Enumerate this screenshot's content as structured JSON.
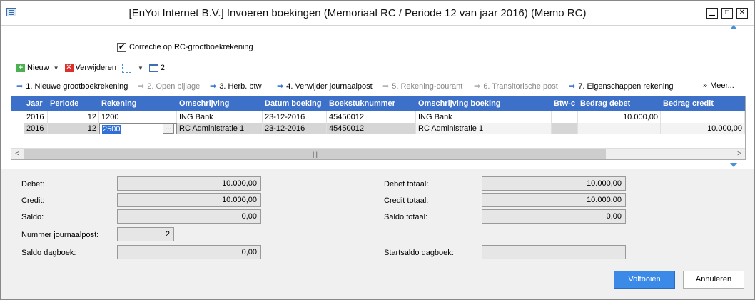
{
  "window": {
    "title": "[EnYoi Internet B.V.]  Invoeren boekingen (Memoriaal RC / Periode 12 van jaar 2016) (Memo RC)",
    "min_glyph": "▁",
    "max_glyph": "□",
    "close_glyph": "✕"
  },
  "checkbox": {
    "label": "Correctie op RC-grootboekrekening",
    "checked": true
  },
  "toolbar": {
    "new_label": "Nieuw",
    "delete_label": "Verwijderen",
    "calendar_count": "2"
  },
  "steps": [
    {
      "label": "1. Nieuwe grootboekrekening",
      "enabled": true
    },
    {
      "label": "2. Open bijlage",
      "enabled": false
    },
    {
      "label": "3. Herb. btw",
      "enabled": true
    },
    {
      "label": "4. Verwijder journaalpost",
      "enabled": true
    },
    {
      "label": "5. Rekening-courant",
      "enabled": false
    },
    {
      "label": "6. Transitorische post",
      "enabled": false
    },
    {
      "label": "7. Eigenschappen rekening",
      "enabled": true
    },
    {
      "label": "Meer...",
      "enabled": true
    }
  ],
  "grid": {
    "columns": [
      "Jaar",
      "Periode",
      "Rekening",
      "Omschrijving",
      "Datum boeking",
      "Boekstuknummer",
      "Omschrijving boeking",
      "Btw-c",
      "Bedrag debet",
      "Bedrag credit"
    ],
    "rows": [
      {
        "jaar": "2016",
        "periode": "12",
        "rekening": "1200",
        "omschrijving": "ING Bank",
        "datum": "23-12-2016",
        "boekstuk": "45450012",
        "omschrijving_boeking": "ING Bank",
        "btw": "",
        "debet": "10.000,00",
        "credit": ""
      },
      {
        "jaar": "2016",
        "periode": "12",
        "rekening": "2500",
        "omschrijving": "RC Administratie 1",
        "datum": "23-12-2016",
        "boekstuk": "45450012",
        "omschrijving_boeking": "RC Administratie 1",
        "btw": "",
        "debet": "",
        "credit": "10.000,00"
      }
    ],
    "scroll_thumb_glyph": "|||"
  },
  "summary": {
    "debet_label": "Debet:",
    "debet_value": "10.000,00",
    "credit_label": "Credit:",
    "credit_value": "10.000,00",
    "saldo_label": "Saldo:",
    "saldo_value": "0,00",
    "journaalpost_label": "Nummer journaalpost:",
    "journaalpost_value": "2",
    "saldo_dagboek_label": "Saldo dagboek:",
    "saldo_dagboek_value": "0,00",
    "debet_totaal_label": "Debet totaal:",
    "debet_totaal_value": "10.000,00",
    "credit_totaal_label": "Credit totaal:",
    "credit_totaal_value": "10.000,00",
    "saldo_totaal_label": "Saldo totaal:",
    "saldo_totaal_value": "0,00",
    "startsaldo_label": "Startsaldo dagboek:",
    "startsaldo_value": ""
  },
  "buttons": {
    "finish_label": "Voltooien",
    "cancel_label": "Annuleren"
  },
  "colors": {
    "grid_header": "#3d70c8",
    "primary_button": "#3c8ae8",
    "step_arrow": "#2f6fd6"
  }
}
